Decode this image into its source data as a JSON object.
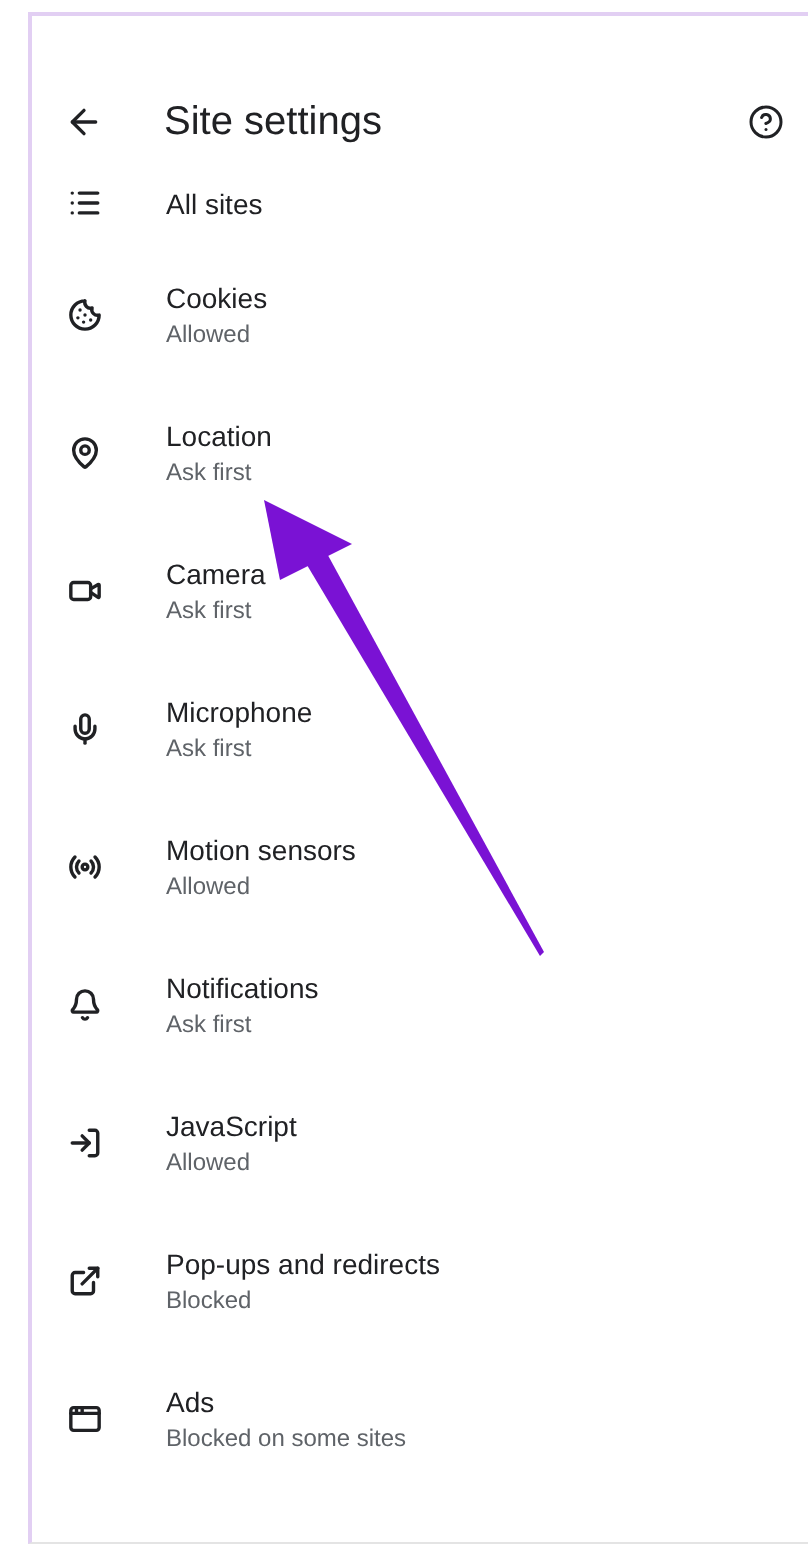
{
  "header": {
    "title": "Site settings"
  },
  "items": [
    {
      "kind": "list",
      "title": "All sites"
    },
    {
      "kind": "cookie",
      "title": "Cookies",
      "status": "Allowed"
    },
    {
      "kind": "pin",
      "title": "Location",
      "status": "Ask first"
    },
    {
      "kind": "camera",
      "title": "Camera",
      "status": "Ask first"
    },
    {
      "kind": "mic",
      "title": "Microphone",
      "status": "Ask first"
    },
    {
      "kind": "sensor",
      "title": "Motion sensors",
      "status": "Allowed"
    },
    {
      "kind": "bell",
      "title": "Notifications",
      "status": "Ask first"
    },
    {
      "kind": "script",
      "title": "JavaScript",
      "status": "Allowed"
    },
    {
      "kind": "popup",
      "title": "Pop-ups and redirects",
      "status": "Blocked"
    },
    {
      "kind": "window",
      "title": "Ads",
      "status": "Blocked on some sites"
    }
  ]
}
